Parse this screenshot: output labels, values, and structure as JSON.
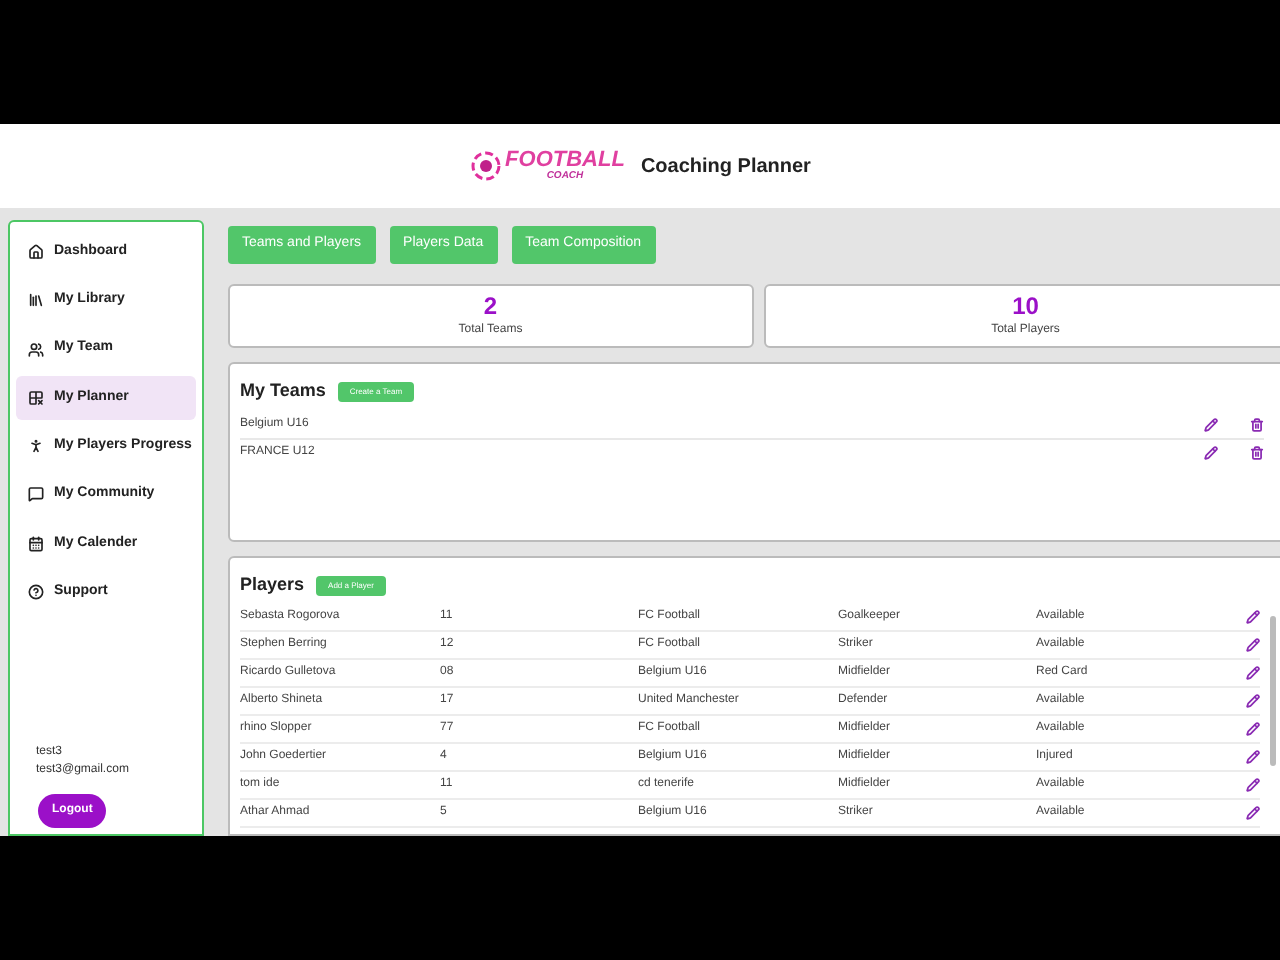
{
  "header": {
    "logo_title": "FOOTBALL",
    "logo_subtitle": "COACH",
    "title": "Coaching Planner"
  },
  "sidebar": {
    "items": [
      {
        "label": "Dashboard",
        "selected": false
      },
      {
        "label": "My Library",
        "selected": false
      },
      {
        "label": "My Team",
        "selected": false
      },
      {
        "label": "My Planner",
        "selected": true
      },
      {
        "label": "My Players Progress",
        "selected": false
      },
      {
        "label": "My Community",
        "selected": false
      },
      {
        "label": "My Calender",
        "selected": false
      },
      {
        "label": "Support",
        "selected": false
      }
    ],
    "user": {
      "name": "test3",
      "email": "test3@gmail.com"
    },
    "logout": "Logout"
  },
  "tabs": [
    "Teams and Players",
    "Players Data",
    "Team Composition"
  ],
  "stats": [
    {
      "value": "2",
      "label": "Total Teams"
    },
    {
      "value": "10",
      "label": "Total Players"
    }
  ],
  "teams": {
    "title": "My Teams",
    "button": "Create a Team",
    "rows": [
      "Belgium U16",
      "FRANCE U12"
    ]
  },
  "players": {
    "title": "Players",
    "button": "Add a Player",
    "rows": [
      [
        "Sebasta Rogorova",
        "11",
        "FC Football",
        "Goalkeeper",
        "Available"
      ],
      [
        "Stephen Berring",
        "12",
        "FC Football",
        "Striker",
        "Available"
      ],
      [
        "Ricardo Gulletova",
        "08",
        "Belgium U16",
        "Midfielder",
        "Red Card"
      ],
      [
        "Alberto Shineta",
        "17",
        "United Manchester",
        "Defender",
        "Available"
      ],
      [
        "rhino Slopper",
        "77",
        "FC Football",
        "Midfielder",
        "Available"
      ],
      [
        "John  Goedertier",
        "4",
        "Belgium U16",
        "Midfielder",
        "Injured"
      ],
      [
        "tom ide",
        "11",
        "cd tenerife",
        "Midfielder",
        "Available"
      ],
      [
        "Athar Ahmad",
        "5",
        "Belgium U16",
        "Striker",
        "Available"
      ]
    ]
  }
}
